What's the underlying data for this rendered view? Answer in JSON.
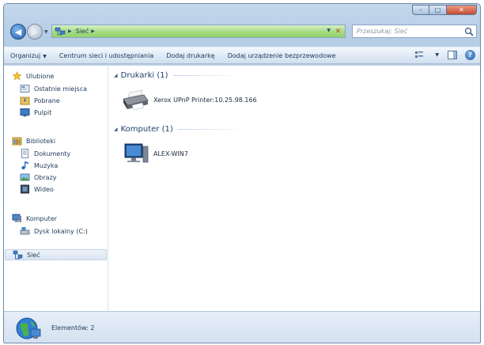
{
  "window": {
    "caption": {
      "minimize": "–",
      "maximize": "□",
      "close": "✕"
    }
  },
  "address": {
    "crumbs": [
      "Sieć"
    ],
    "search_placeholder": "Przeszukaj: Sieć"
  },
  "commandbar": {
    "organize": "Organizuj",
    "network_center": "Centrum sieci i udostępniania",
    "add_printer": "Dodaj drukarkę",
    "add_device": "Dodaj urządzenie bezprzewodowe",
    "help": "?"
  },
  "sidebar": {
    "favorites": {
      "label": "Ulubione",
      "items": [
        "Ostatnie miejsca",
        "Pobrane",
        "Pulpit"
      ]
    },
    "libraries": {
      "label": "Biblioteki",
      "items": [
        "Dokumenty",
        "Muzyka",
        "Obrazy",
        "Wideo"
      ]
    },
    "computer": {
      "label": "Komputer",
      "items": [
        "Dysk lokalny (C:)"
      ]
    },
    "network": {
      "label": "Sieć"
    }
  },
  "groups": [
    {
      "title": "Drukarki (1)",
      "device": "Xerox UPnP Printer:10.25.98.166"
    },
    {
      "title": "Komputer (1)",
      "device": "ALEX-WIN7"
    }
  ],
  "details": {
    "count_text": "Elementów: 2"
  },
  "colors": {
    "address_bar": "#a8dc86",
    "selection": "#dbe6f2",
    "accent": "#1e395b"
  }
}
